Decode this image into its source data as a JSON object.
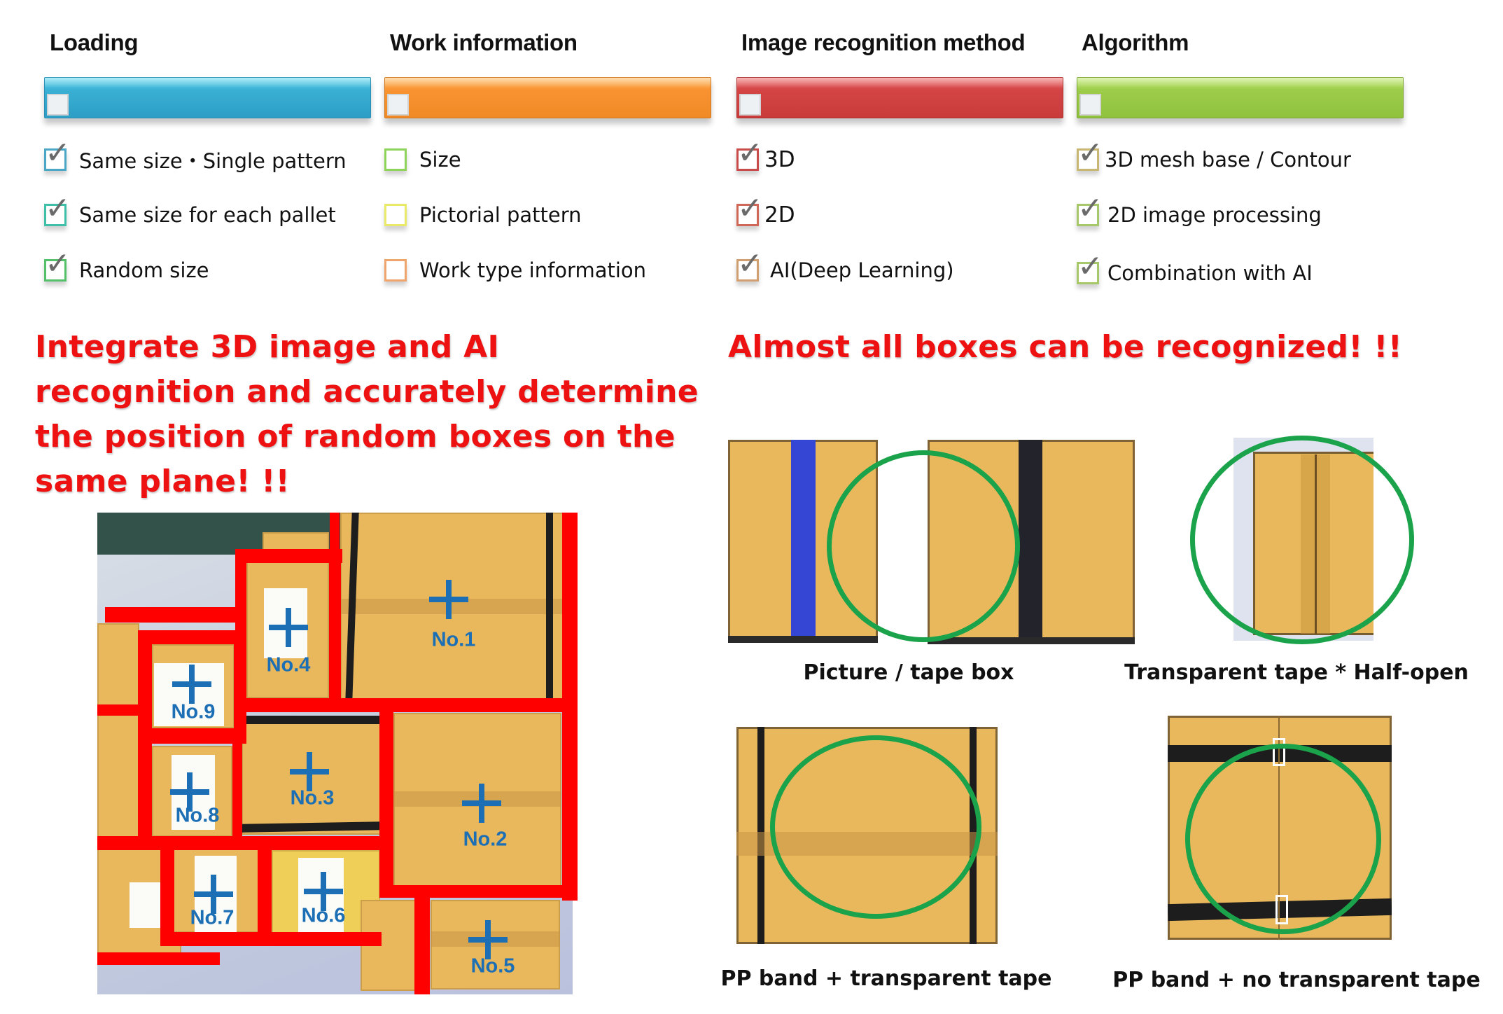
{
  "categories": [
    {
      "title": "Loading",
      "color": "#2d9ec6",
      "options": [
        {
          "label": "Same size・Single pattern",
          "checked": true,
          "box_color": "#4aa7c5"
        },
        {
          "label": "Same size for each pallet",
          "checked": true,
          "box_color": "#3fbfa7"
        },
        {
          "label": "Random size",
          "checked": true,
          "box_color": "#55c06a"
        }
      ]
    },
    {
      "title": "Work information",
      "color": "#f08a26",
      "options": [
        {
          "label": "Size",
          "checked": false,
          "box_color": "#8fd45a"
        },
        {
          "label": "Pictorial pattern",
          "checked": false,
          "box_color": "#e9ea6a"
        },
        {
          "label": "Work type information",
          "checked": false,
          "box_color": "#eea46a"
        }
      ]
    },
    {
      "title": "Image recognition method",
      "color": "#c93b3b",
      "options": [
        {
          "label": "3D",
          "checked": true,
          "box_color": "#c84c4c"
        },
        {
          "label": "2D",
          "checked": true,
          "box_color": "#d0685a"
        },
        {
          "label": "AI(Deep Learning)",
          "checked": true,
          "box_color": "#d2a070"
        }
      ]
    },
    {
      "title": "Algorithm",
      "color": "#90c23e",
      "options": [
        {
          "label": "3D mesh base / Contour",
          "checked": true,
          "box_color": "#c8b772"
        },
        {
          "label": "2D image processing",
          "checked": true,
          "box_color": "#a6c86a"
        },
        {
          "label": "Combination with AI",
          "checked": true,
          "box_color": "#a6c86a"
        }
      ]
    }
  ],
  "check_glyph": "✓",
  "headline_left": [
    "Integrate 3D image and AI",
    "recognition and accurately determine",
    "the position of random boxes on the",
    "same plane! !!"
  ],
  "headline_right": "Almost all boxes can be recognized! !!",
  "scene": {
    "boxes": [
      {
        "id": "No.1"
      },
      {
        "id": "No.2"
      },
      {
        "id": "No.3"
      },
      {
        "id": "No.4"
      },
      {
        "id": "No.5"
      },
      {
        "id": "No.6"
      },
      {
        "id": "No.7"
      },
      {
        "id": "No.8"
      },
      {
        "id": "No.9"
      }
    ],
    "outline_color": "#ff0000",
    "marker_color": "#1c6fb5"
  },
  "examples": [
    {
      "caption": "Picture / tape box"
    },
    {
      "caption": "Transparent tape * Half-open"
    },
    {
      "caption": "PP band + transparent tape"
    },
    {
      "caption": "PP band + no transparent tape"
    }
  ],
  "highlight_color": "#1aa34a"
}
